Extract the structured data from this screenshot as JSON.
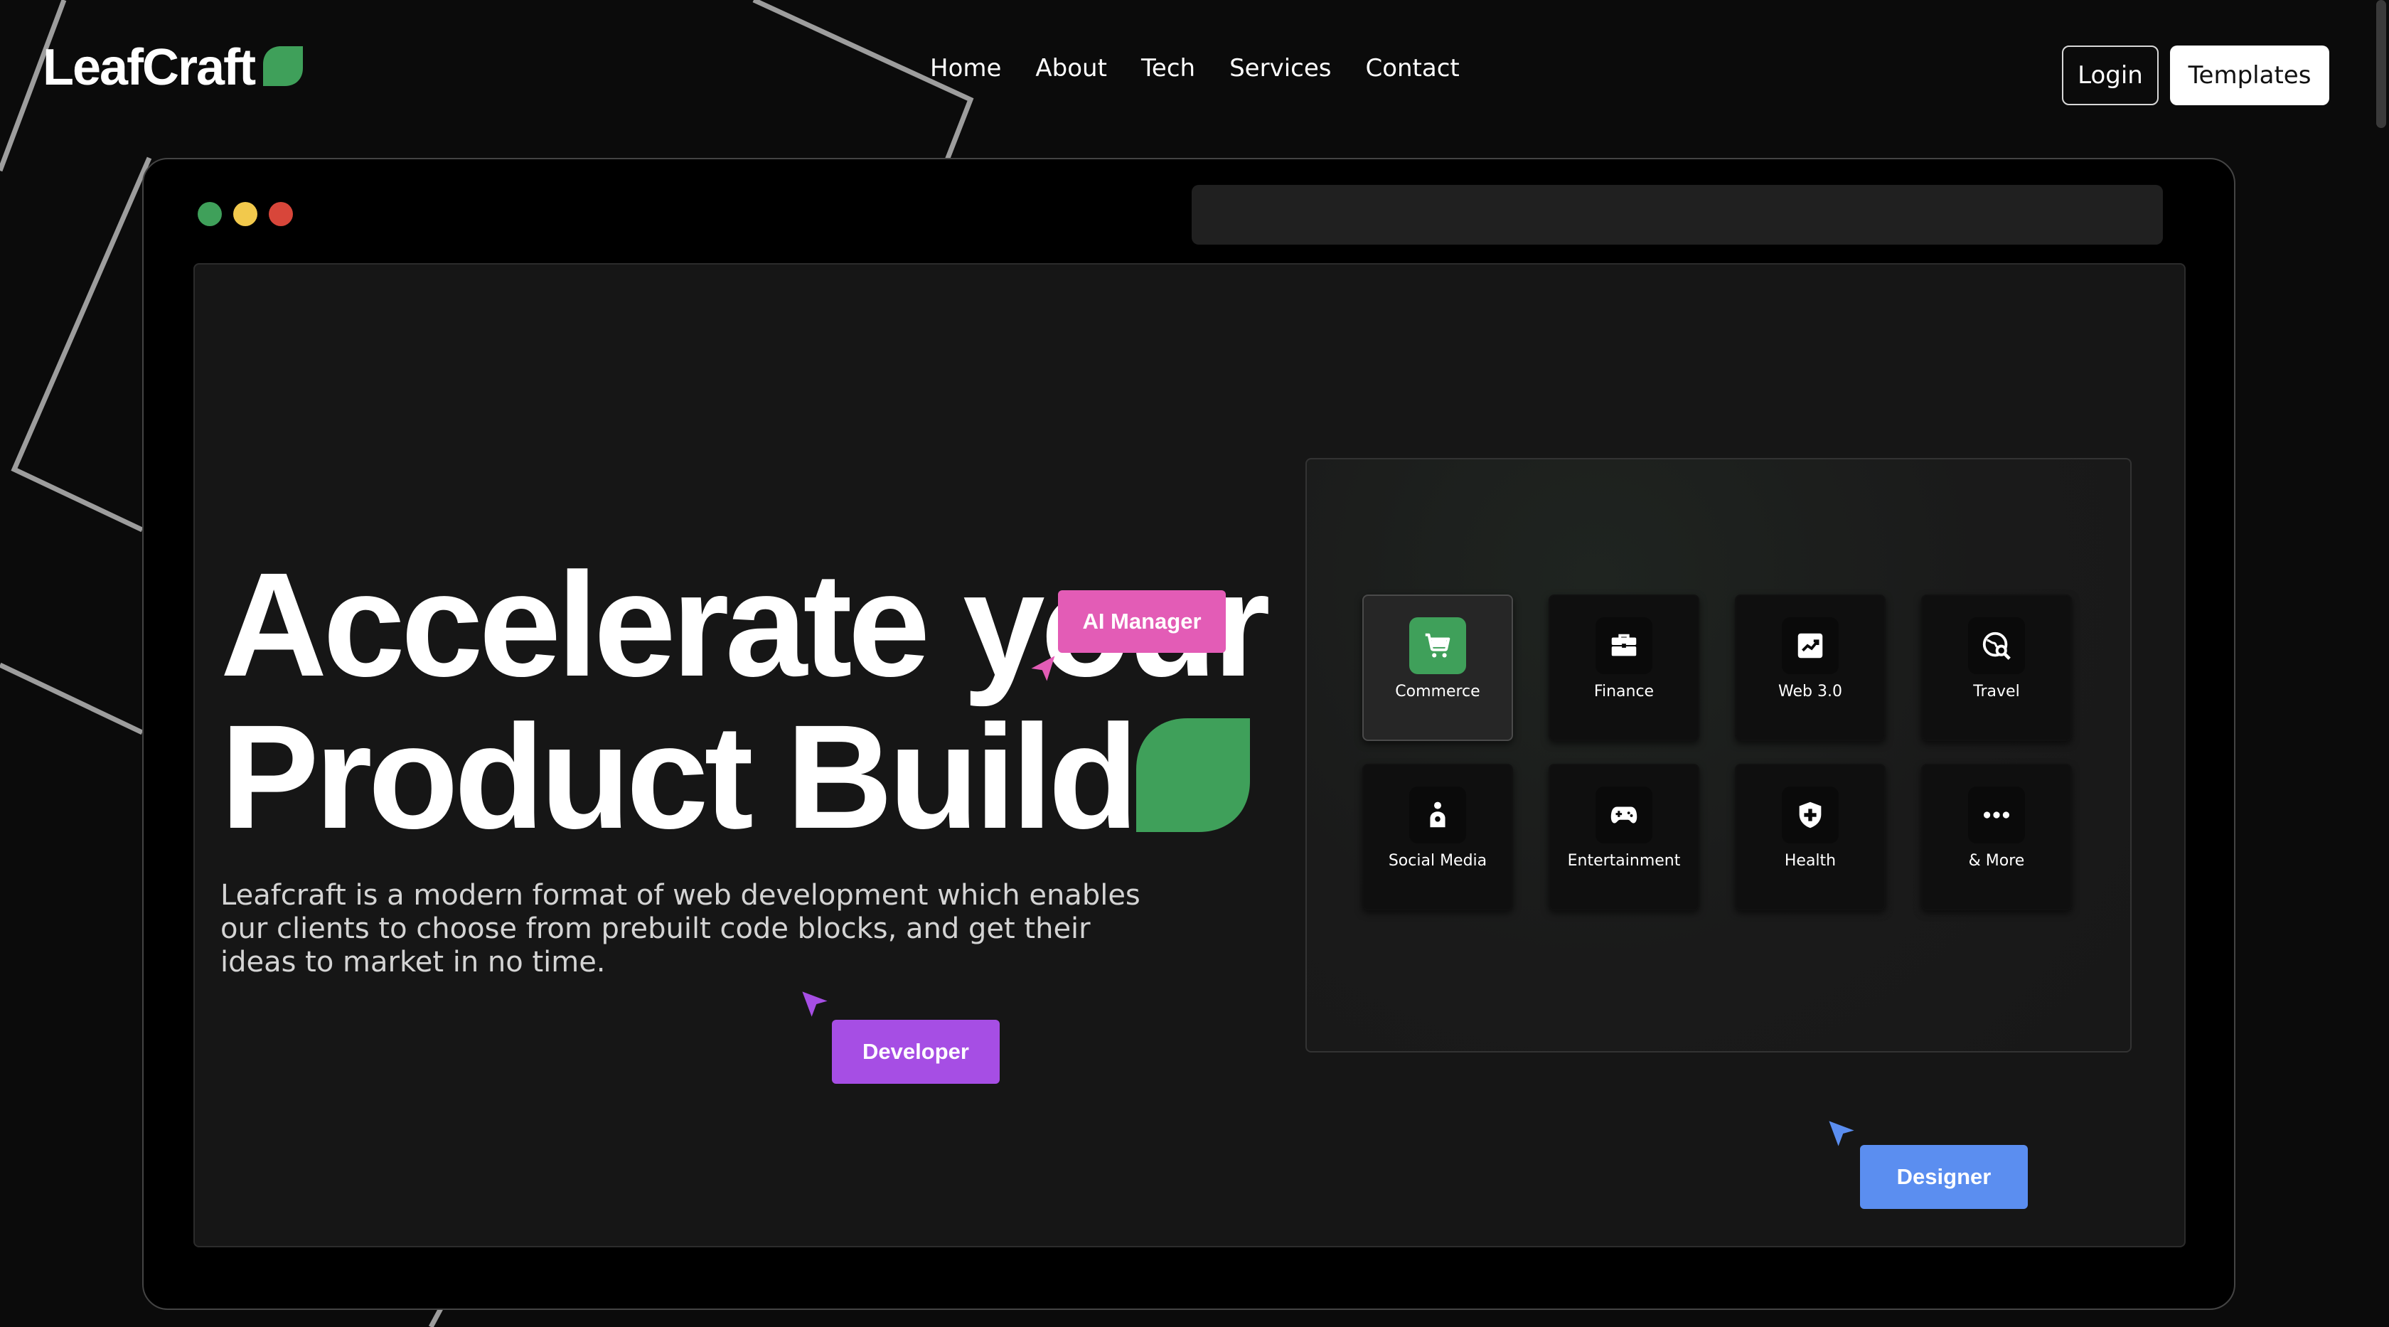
{
  "brand": {
    "name": "LeafCraft",
    "accent_color": "#3fa05a",
    "logo_icon": "leaf-icon"
  },
  "nav": {
    "items": [
      "Home",
      "About",
      "Tech",
      "Services",
      "Contact"
    ]
  },
  "header": {
    "login_label": "Login",
    "templates_label": "Templates"
  },
  "hero": {
    "title_line1": "Accelerate your",
    "title_line2": "Product Build",
    "description": "Leafcraft is a modern format of web development which enables our clients to choose from prebuilt code blocks, and get their ideas to market in no time."
  },
  "tags": {
    "ai_manager": {
      "label": "AI Manager",
      "color": "#e35cb6"
    },
    "developer": {
      "label": "Developer",
      "color": "#a64ee4"
    },
    "designer": {
      "label": "Designer",
      "color": "#5b8ef0"
    }
  },
  "categories": [
    {
      "label": "Commerce",
      "icon": "shopping-cart-icon",
      "active": true
    },
    {
      "label": "Finance",
      "icon": "briefcase-icon",
      "active": false
    },
    {
      "label": "Web 3.0",
      "icon": "chart-trend-icon",
      "active": false
    },
    {
      "label": "Travel",
      "icon": "globe-search-icon",
      "active": false
    },
    {
      "label": "Social Media",
      "icon": "person-icon",
      "active": false
    },
    {
      "label": "Entertainment",
      "icon": "gamepad-icon",
      "active": false
    },
    {
      "label": "Health",
      "icon": "shield-plus-icon",
      "active": false
    },
    {
      "label": "& More",
      "icon": "more-dots-icon",
      "active": false
    }
  ],
  "window_dots": {
    "green": "#3fa05a",
    "yellow": "#f2c94c",
    "red": "#d8463a"
  }
}
